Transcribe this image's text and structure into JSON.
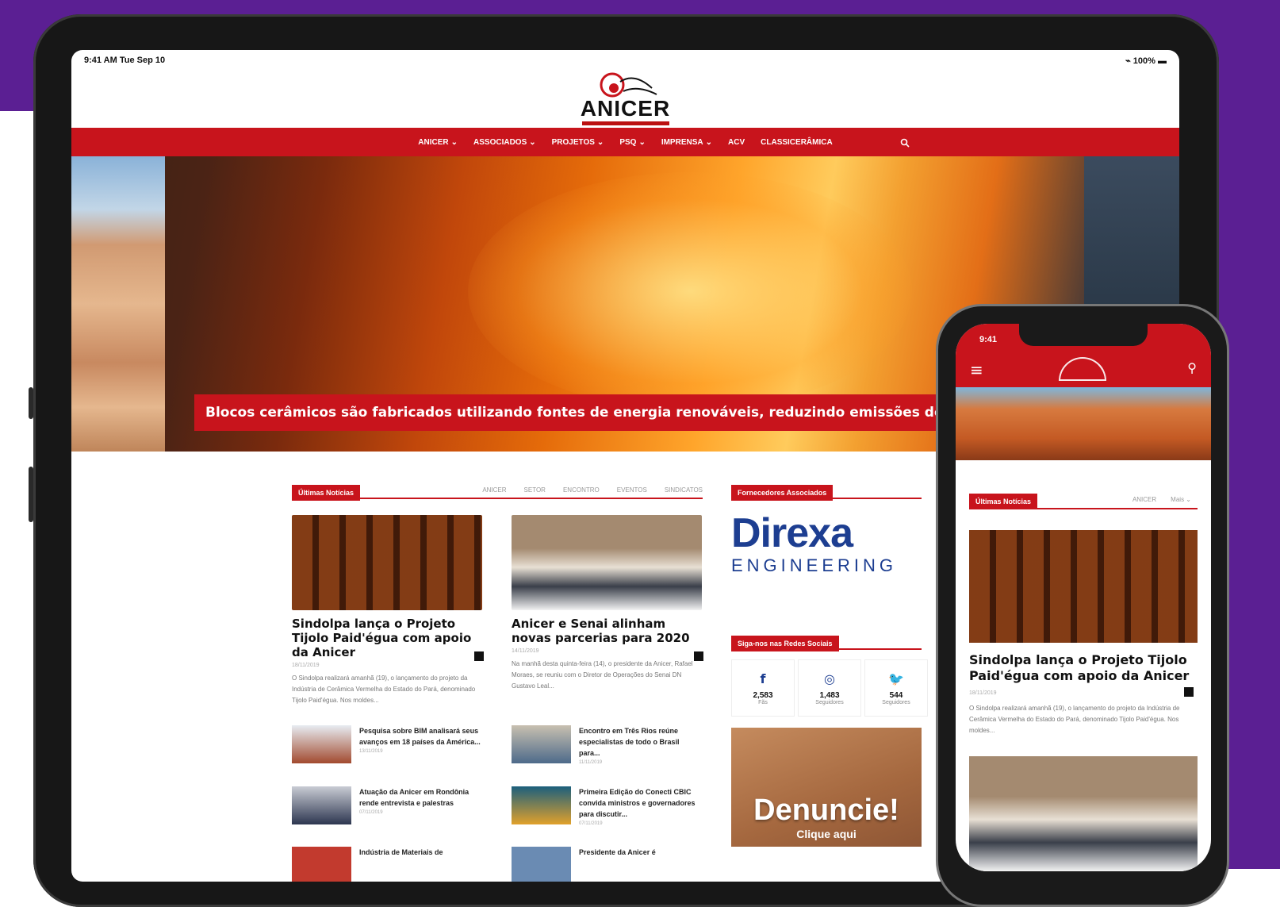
{
  "status": {
    "time": "9:41 AM  Tue Sep 10",
    "battery": "100%"
  },
  "brand": {
    "name": "ANICER"
  },
  "nav": {
    "items": [
      "ANICER",
      "ASSOCIADOS",
      "PROJETOS",
      "PSQ",
      "IMPRENSA",
      "ACV",
      "CLASSICERÂMICA"
    ]
  },
  "hero": {
    "caption": "Blocos cerâmicos são fabricados utilizando fontes de energia renováveis, reduzindo emissões de metano"
  },
  "news": {
    "label": "Últimas Notícias",
    "tabs": [
      "ANICER",
      "SETOR",
      "ENCONTRO",
      "EVENTOS",
      "SINDICATOS"
    ],
    "featured": [
      {
        "title": "Sindolpa lança o Projeto Tijolo Paid'égua com apoio da Anicer",
        "date": "18/11/2019",
        "excerpt": "O Sindolpa realizará amanhã (19), o lançamento do projeto da Indústria de Cerâmica Vermelha do Estado do Pará, denominado Tijolo Paid'égua. Nos moldes..."
      },
      {
        "title": "Anicer e Senai alinham novas parcerias para 2020",
        "date": "14/11/2019",
        "excerpt": "Na manhã desta quinta-feira (14), o presidente da Anicer, Rafael Moraes, se reuniu com o Diretor de Operações do Senai DN Gustavo Leal..."
      }
    ],
    "small": [
      {
        "title": "Pesquisa sobre BIM analisará seus avanços em 18 países da América...",
        "date": "13/11/2019"
      },
      {
        "title": "Encontro em Três Rios reúne especialistas de todo o Brasil para...",
        "date": "11/11/2019"
      },
      {
        "title": "Atuação da Anicer em Rondônia rende entrevista e palestras",
        "date": "07/11/2019"
      },
      {
        "title": "Primeira Edição do Conecti CBIC convida ministros e governadores para discutir...",
        "date": "07/11/2019"
      },
      {
        "title": "Indústria de Materiais de",
        "date": ""
      },
      {
        "title": "Presidente da Anicer é",
        "date": ""
      }
    ]
  },
  "sidebar": {
    "suppliers_label": "Fornecedores Associados",
    "direxa_main": "Direxa",
    "direxa_sub": "ENGINEERING",
    "social_label": "Siga-nos nas Redes Sociais",
    "social": [
      {
        "icon": "f",
        "count": "2,583",
        "label": "Fãs"
      },
      {
        "icon": "◎",
        "count": "1,483",
        "label": "Seguidores"
      },
      {
        "icon": "🐦",
        "count": "544",
        "label": "Seguidores"
      }
    ],
    "denuncie": "Denuncie!",
    "denuncie_sub": "Clique aqui"
  },
  "phone": {
    "time": "9:41",
    "news_label": "Últimas Notícias",
    "tabs": [
      "ANICER",
      "Mais"
    ],
    "title": "Sindolpa lança o Projeto Tijolo Paid'égua com apoio da Anicer",
    "date": "18/11/2019",
    "excerpt": "O Sindolpa realizará amanhã (19), o lançamento do projeto da Indústria de Cerâmica Vermelha do Estado do Pará, denominado Tijolo Paid'égua. Nos moldes..."
  }
}
